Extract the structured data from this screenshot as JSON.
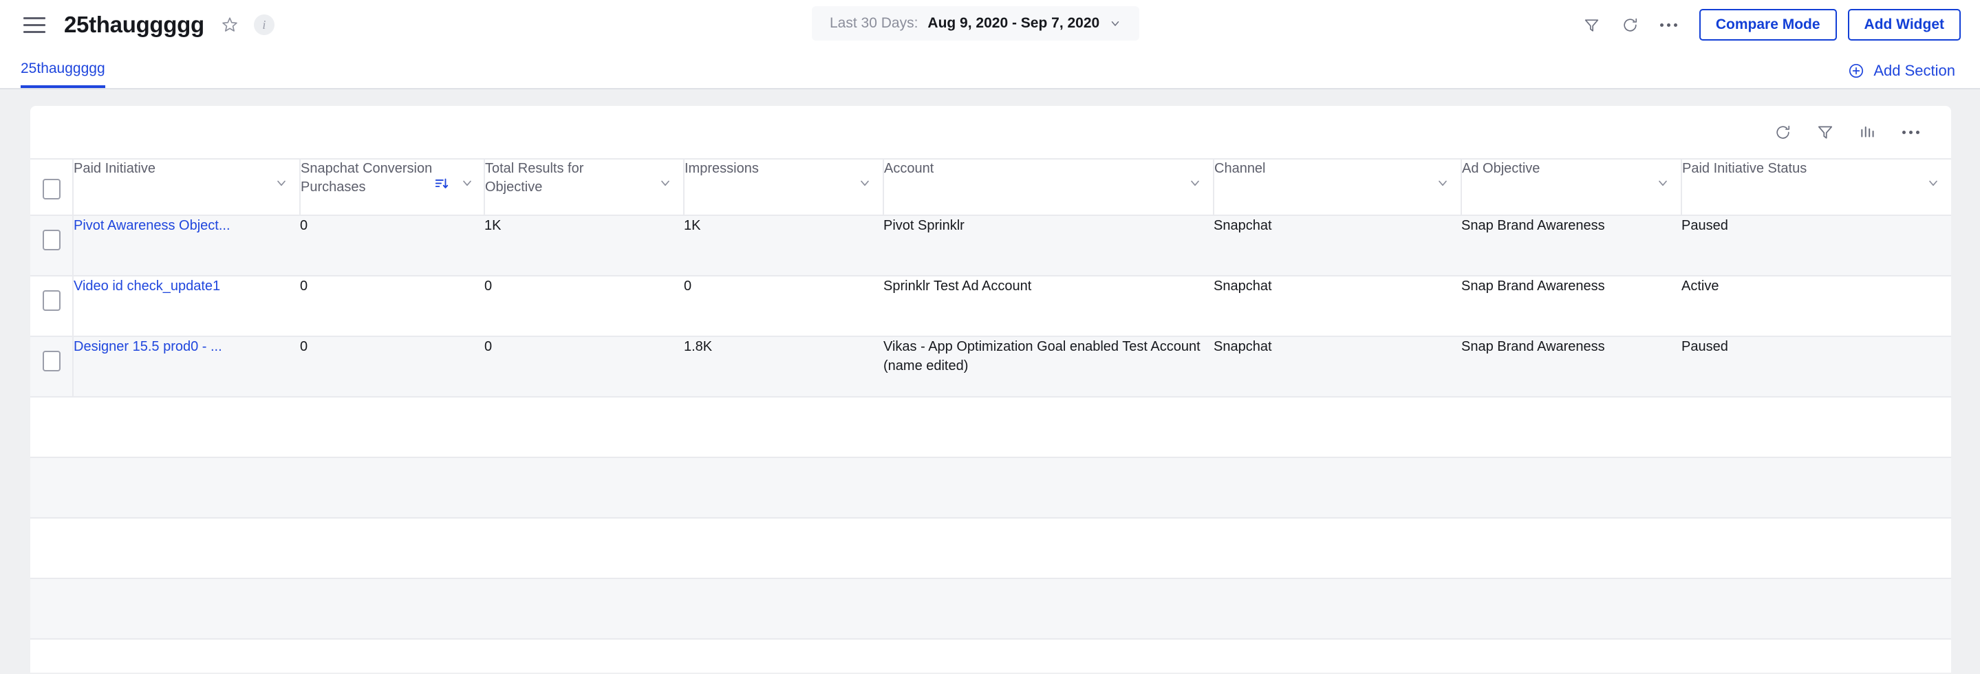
{
  "topbar": {
    "menu_icon": "hamburger-icon",
    "title": "25thauggggg",
    "star_icon": "star-outline-icon",
    "info_icon": "info-icon",
    "daterange": {
      "label": "Last 30 Days:",
      "value": "Aug 9, 2020 - Sep 7, 2020",
      "chevron_icon": "chevron-down-icon"
    },
    "actions": {
      "filter_icon": "filter-icon",
      "refresh_icon": "refresh-icon",
      "more_icon": "ellipsis-icon",
      "compare_mode_label": "Compare Mode",
      "add_widget_label": "Add Widget"
    }
  },
  "tabbar": {
    "tabs": [
      {
        "label": "25thauggggg",
        "active": true
      }
    ],
    "add_section_label": "Add Section",
    "add_section_icon": "plus-circle-icon"
  },
  "widget": {
    "toolbar": {
      "refresh_icon": "refresh-icon",
      "filter_icon": "filter-icon",
      "chart_icon": "bar-chart-icon",
      "more_icon": "ellipsis-icon"
    },
    "table": {
      "columns": [
        {
          "label": "Paid Initiative",
          "sorted": false
        },
        {
          "label": "Snapchat Conversion Purchases",
          "sorted": true,
          "sort_direction": "desc"
        },
        {
          "label": "Total Results for Objective",
          "sorted": false
        },
        {
          "label": "Impressions",
          "sorted": false
        },
        {
          "label": "Account",
          "sorted": false
        },
        {
          "label": "Channel",
          "sorted": false
        },
        {
          "label": "Ad Objective",
          "sorted": false
        },
        {
          "label": "Paid Initiative Status",
          "sorted": false
        }
      ],
      "rows": [
        {
          "paid_initiative": "Pivot Awareness Object...",
          "snapchat_conversion_purchases": "0",
          "total_results_for_objective": "1K",
          "impressions": "1K",
          "account": "Pivot Sprinklr",
          "channel": "Snapchat",
          "ad_objective": "Snap Brand Awareness",
          "paid_initiative_status": "Paused"
        },
        {
          "paid_initiative": "Video id check_update1",
          "snapchat_conversion_purchases": "0",
          "total_results_for_objective": "0",
          "impressions": "0",
          "account": "Sprinklr Test Ad Account",
          "channel": "Snapchat",
          "ad_objective": "Snap Brand Awareness",
          "paid_initiative_status": "Active"
        },
        {
          "paid_initiative": "Designer 15.5 prod0 - ...",
          "snapchat_conversion_purchases": "0",
          "total_results_for_objective": "0",
          "impressions": "1.8K",
          "account": "Vikas - App Optimization Goal enabled Test Account (name edited)",
          "channel": "Snapchat",
          "ad_objective": "Snap Brand Awareness",
          "paid_initiative_status": "Paused"
        }
      ],
      "empty_row_count": 4
    }
  },
  "colors": {
    "accent": "#1f46dd",
    "page_background": "#eff0f2",
    "row_alt_background": "#f6f7f9",
    "border": "#e9eaee",
    "muted_text": "#5c5e6b"
  }
}
